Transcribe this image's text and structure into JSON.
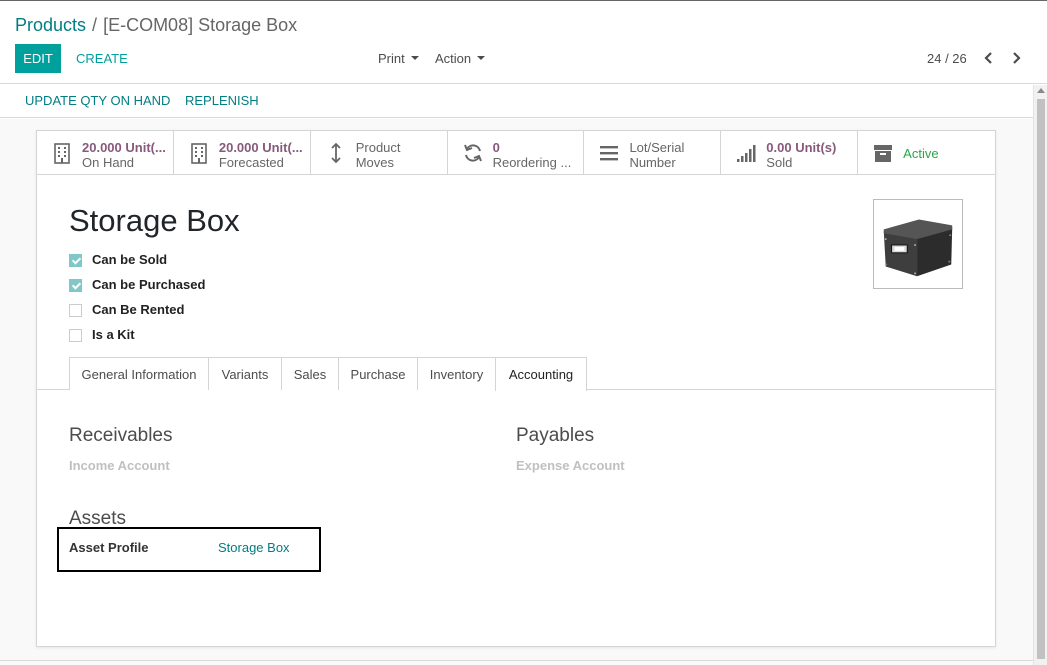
{
  "breadcrumb": {
    "parent": "Products",
    "separator": "/",
    "current": "[E-COM08] Storage Box"
  },
  "toolbar": {
    "edit_label": "EDIT",
    "create_label": "CREATE",
    "print_label": "Print",
    "action_label": "Action"
  },
  "pager": {
    "value": "24 / 26"
  },
  "statusbar": {
    "update_qty_label": "UPDATE QTY ON HAND",
    "replenish_label": "REPLENISH"
  },
  "stat_buttons": {
    "on_hand": {
      "value": "20.000 Unit(...",
      "label": "On Hand",
      "icon": "building-icon"
    },
    "forecasted": {
      "value": "20.000 Unit(...",
      "label": "Forecasted",
      "icon": "building-icon"
    },
    "moves": {
      "line1": "Product",
      "line2": "Moves",
      "icon": "arrows-vertical-icon"
    },
    "reordering": {
      "value": "0",
      "label": "Reordering ...",
      "icon": "refresh-icon"
    },
    "lots": {
      "line1": "Lot/Serial",
      "line2": "Number",
      "icon": "list-icon"
    },
    "sold": {
      "value": "0.00 Unit(s)",
      "label": "Sold",
      "icon": "signal-bars-icon"
    },
    "active": {
      "label": "Active",
      "icon": "archive-box-icon"
    }
  },
  "product": {
    "name": "Storage Box",
    "checkboxes": [
      {
        "label": "Can be Sold",
        "checked": true
      },
      {
        "label": "Can be Purchased",
        "checked": true
      },
      {
        "label": "Can Be Rented",
        "checked": false
      },
      {
        "label": "Is a Kit",
        "checked": false
      }
    ]
  },
  "tabs": [
    {
      "label": "General Information"
    },
    {
      "label": "Variants"
    },
    {
      "label": "Sales"
    },
    {
      "label": "Purchase"
    },
    {
      "label": "Inventory"
    },
    {
      "label": "Accounting",
      "active": true
    }
  ],
  "accounting": {
    "receivables_title": "Receivables",
    "income_account_label": "Income Account",
    "payables_title": "Payables",
    "expense_account_label": "Expense Account",
    "assets_title": "Assets",
    "asset_profile_label": "Asset Profile",
    "asset_profile_value": "Storage Box"
  },
  "colors": {
    "primary": "#00a09d",
    "link": "#017e84",
    "stat_value": "#875a7b",
    "active_green": "#28a745"
  }
}
